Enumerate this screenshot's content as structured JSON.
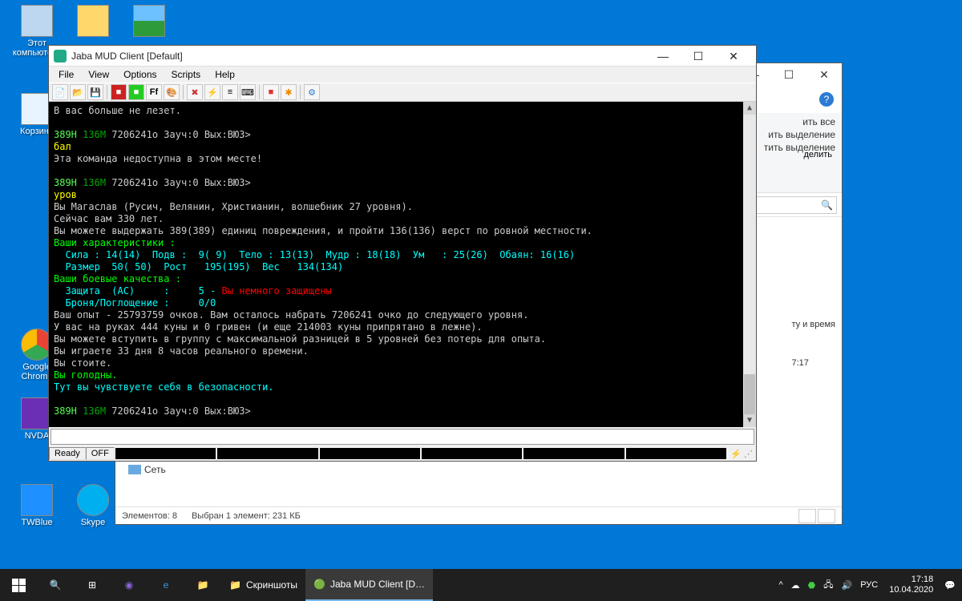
{
  "desktop_icons": {
    "pc": "Этот\nкомпьюте…",
    "folder": "",
    "picture": "",
    "recycle": "Корзина",
    "chrome": "Google\nChrome",
    "nvda": "NVDA",
    "twblue": "TWBlue",
    "skype": "Skype"
  },
  "explorer": {
    "menu_items": [
      "ить все",
      "ить выделение",
      "тить выделение",
      "делить"
    ],
    "help": "?",
    "side_label1": "ту и время",
    "side_label2": "7:17",
    "net_label": "Сеть",
    "status_elements": "Элементов: 8",
    "status_selected": "Выбран 1 элемент: 231 КБ"
  },
  "mud": {
    "title": "Jaba MUD Client [Default]",
    "menu": {
      "file": "File",
      "view": "View",
      "options": "Options",
      "scripts": "Scripts",
      "help": "Help"
    },
    "status_ready": "Ready",
    "status_off": "OFF",
    "term": {
      "l01": "В вас больше не лезет.",
      "l02": "",
      "p1a": "389H",
      "p1b": "136M",
      "p1c": "7206241o Зауч:0 Вых:ВЮЗ>",
      "l03": "бал",
      "l04": "Эта команда недоступна в этом месте!",
      "l05": "",
      "p2a": "389H",
      "p2b": "136M",
      "p2c": "7206241o Зауч:0 Вых:ВЮЗ>",
      "l06": "уров",
      "l07": "Вы Магаслав (Русич, Велянин, Христианин, волшебник 27 уровня).",
      "l08": "Сейчас вам 330 лет.",
      "l09": "Вы можете выдержать 389(389) единиц повреждения, и пройти 136(136) верст по ровной местности.",
      "l10": "Ваши характеристики :",
      "l11": "  Сила : 14(14)  Подв :  9( 9)  Тело : 13(13)  Мудр : 18(18)  Ум   : 25(26)  Обаян: 16(16)",
      "l12": "  Размер  50( 50)  Рост   195(195)  Вес   134(134)",
      "l13": "Ваши боевые качества :",
      "l14a": "  Защита  (AC)     :     5 - ",
      "l14b": "Вы немного защищены",
      "l15": "  Броня/Поглощение :     0/0",
      "l16": "Ваш опыт - 25793759 очков. Вам осталось набрать 7206241 очко до следующего уровня.",
      "l17": "У вас на руках 444 куны и 0 гривен (и еще 214003 куны припрятано в лежне).",
      "l18": "Вы можете вступить в группу с максимальной разницей в 5 уровней без потерь для опыта.",
      "l19": "Вы играете 33 дня 8 часов реального времени.",
      "l20": "Вы стоите.",
      "l21": "Вы голодны.",
      "l22": "Тут вы чувствуете себя в безопасности.",
      "l23": "",
      "p3a": "389H",
      "p3b": "136M",
      "p3c": "7206241o Зауч:0 Вых:ВЮЗ>"
    }
  },
  "taskbar": {
    "task1": "Скриншоты",
    "task2": "Jaba MUD Client [D…",
    "tray_lang": "РУС",
    "clock_time": "17:18",
    "clock_date": "10.04.2020"
  }
}
